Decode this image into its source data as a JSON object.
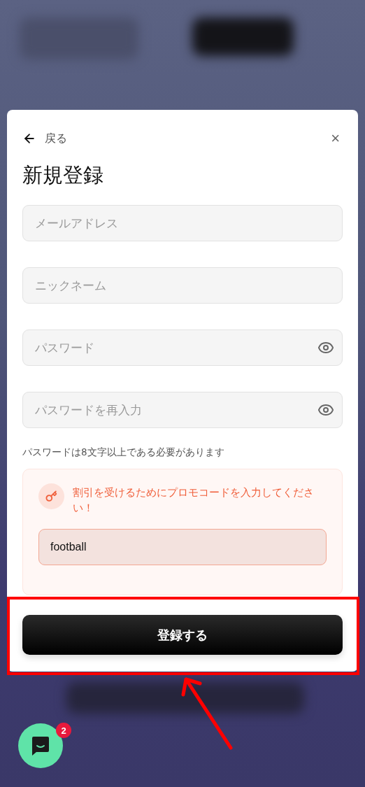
{
  "header": {
    "back_label": "戻る",
    "close": "×"
  },
  "title": "新規登録",
  "fields": [
    {
      "placeholder": "メールアドレス",
      "kind": "text"
    },
    {
      "placeholder": "ニックネーム",
      "kind": "text"
    },
    {
      "placeholder": "パスワード",
      "kind": "password"
    },
    {
      "placeholder": "パスワードを再入力",
      "kind": "password"
    }
  ],
  "password_hint": "パスワードは8文字以上である必要があります",
  "promo": {
    "message": "割引を受けるためにプロモコードを入力してください！",
    "value": "football"
  },
  "submit_button": "登録する",
  "chat": {
    "badge": "2"
  }
}
